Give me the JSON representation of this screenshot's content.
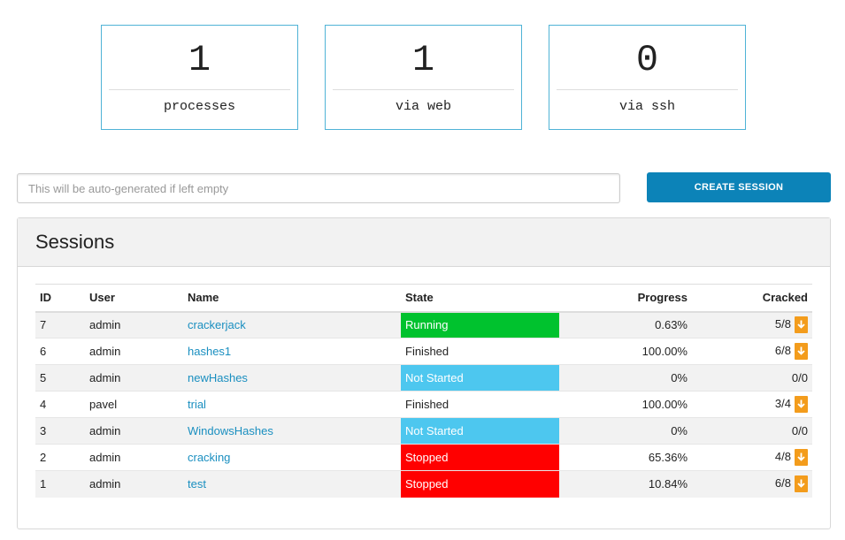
{
  "stats": [
    {
      "value": "1",
      "label": "processes"
    },
    {
      "value": "1",
      "label": "via web"
    },
    {
      "value": "0",
      "label": "via ssh"
    }
  ],
  "create": {
    "input_placeholder": "This will be auto-generated if left empty",
    "input_value": "",
    "button_label": "CREATE SESSION"
  },
  "sessions": {
    "title": "Sessions",
    "columns": {
      "id": "ID",
      "user": "User",
      "name": "Name",
      "state": "State",
      "progress": "Progress",
      "cracked": "Cracked"
    },
    "rows": [
      {
        "id": "7",
        "user": "admin",
        "name": "crackerjack",
        "state": "Running",
        "progress": "0.63%",
        "cracked": "5/8",
        "download": true,
        "state_color": "#00c22e"
      },
      {
        "id": "6",
        "user": "admin",
        "name": "hashes1",
        "state": "Finished",
        "progress": "100.00%",
        "cracked": "6/8",
        "download": true,
        "state_color": ""
      },
      {
        "id": "5",
        "user": "admin",
        "name": "newHashes",
        "state": "Not Started",
        "progress": "0%",
        "cracked": "0/0",
        "download": false,
        "state_color": "#4dc7ef"
      },
      {
        "id": "4",
        "user": "pavel",
        "name": "trial",
        "state": "Finished",
        "progress": "100.00%",
        "cracked": "3/4",
        "download": true,
        "state_color": ""
      },
      {
        "id": "3",
        "user": "admin",
        "name": "WindowsHashes",
        "state": "Not Started",
        "progress": "0%",
        "cracked": "0/0",
        "download": false,
        "state_color": "#4dc7ef"
      },
      {
        "id": "2",
        "user": "admin",
        "name": "cracking",
        "state": "Stopped",
        "progress": "65.36%",
        "cracked": "4/8",
        "download": true,
        "state_color": "#ff0000"
      },
      {
        "id": "1",
        "user": "admin",
        "name": "test",
        "state": "Stopped",
        "progress": "10.84%",
        "cracked": "6/8",
        "download": true,
        "state_color": "#ff0000"
      }
    ]
  },
  "colors": {
    "accent": "#0c83b8",
    "box_border": "#4fb3d6",
    "link": "#1a8fc0",
    "download_icon": "#f39c1c"
  },
  "icons": {
    "download": "download-file-icon"
  }
}
